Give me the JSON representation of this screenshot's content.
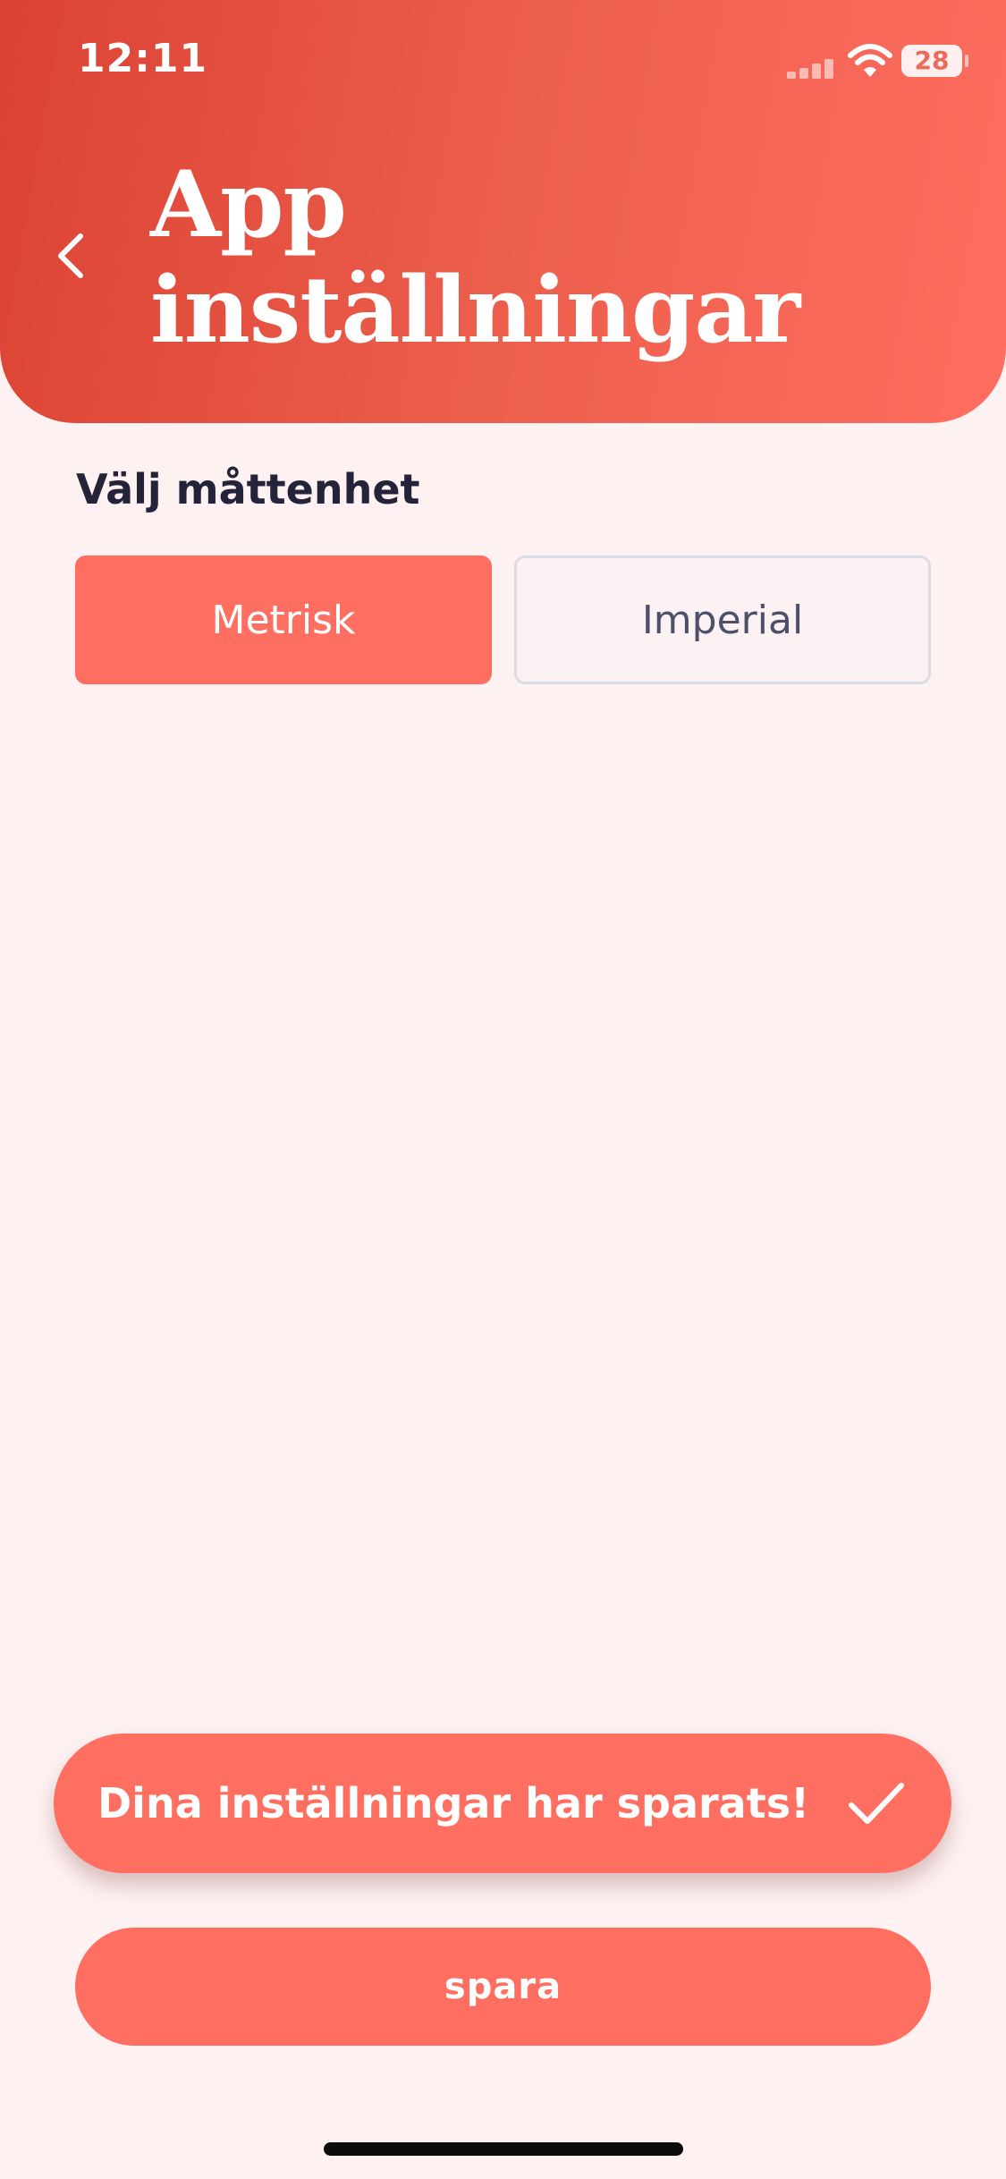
{
  "status_bar": {
    "time": "12:11",
    "battery": "28",
    "icons": [
      "signal-icon",
      "wifi-icon",
      "battery-icon"
    ]
  },
  "header": {
    "title_line1": "App",
    "title_line2": "inställningar",
    "back_icon": "chevron-left-icon"
  },
  "units": {
    "label": "Välj måttenhet",
    "options": [
      {
        "label": "Metrisk",
        "selected": true
      },
      {
        "label": "Imperial",
        "selected": false
      }
    ]
  },
  "toast": {
    "message": "Dina inställningar har sparats!",
    "icon": "check-icon"
  },
  "save_button": {
    "label": "spara"
  },
  "colors": {
    "background": "#fdf1f1",
    "accent": "#fe6f62",
    "header_start": "#dc4233",
    "header_end": "#ff6e60",
    "text_dark": "#24233a"
  }
}
